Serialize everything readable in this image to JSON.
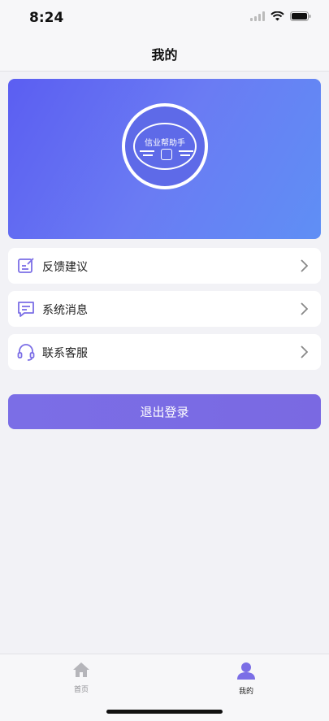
{
  "status_bar": {
    "time": "8:24"
  },
  "header": {
    "title": "我的"
  },
  "banner": {
    "logo_text": "信业帮助手"
  },
  "menu": {
    "items": [
      {
        "label": "反馈建议",
        "icon": "feedback-edit-icon"
      },
      {
        "label": "系统消息",
        "icon": "message-icon"
      },
      {
        "label": "联系客服",
        "icon": "headset-icon"
      }
    ]
  },
  "logout_button": {
    "label": "退出登录"
  },
  "tab_bar": {
    "tabs": [
      {
        "label": "首页",
        "icon": "home-icon",
        "active": false
      },
      {
        "label": "我的",
        "icon": "person-icon",
        "active": true
      }
    ]
  },
  "colors": {
    "accent": "#7b6ee6",
    "banner_start": "#5b5ef2",
    "banner_end": "#5f8ff5",
    "icon_purple": "#7b6ee6",
    "tab_inactive": "#b5b5ba"
  }
}
